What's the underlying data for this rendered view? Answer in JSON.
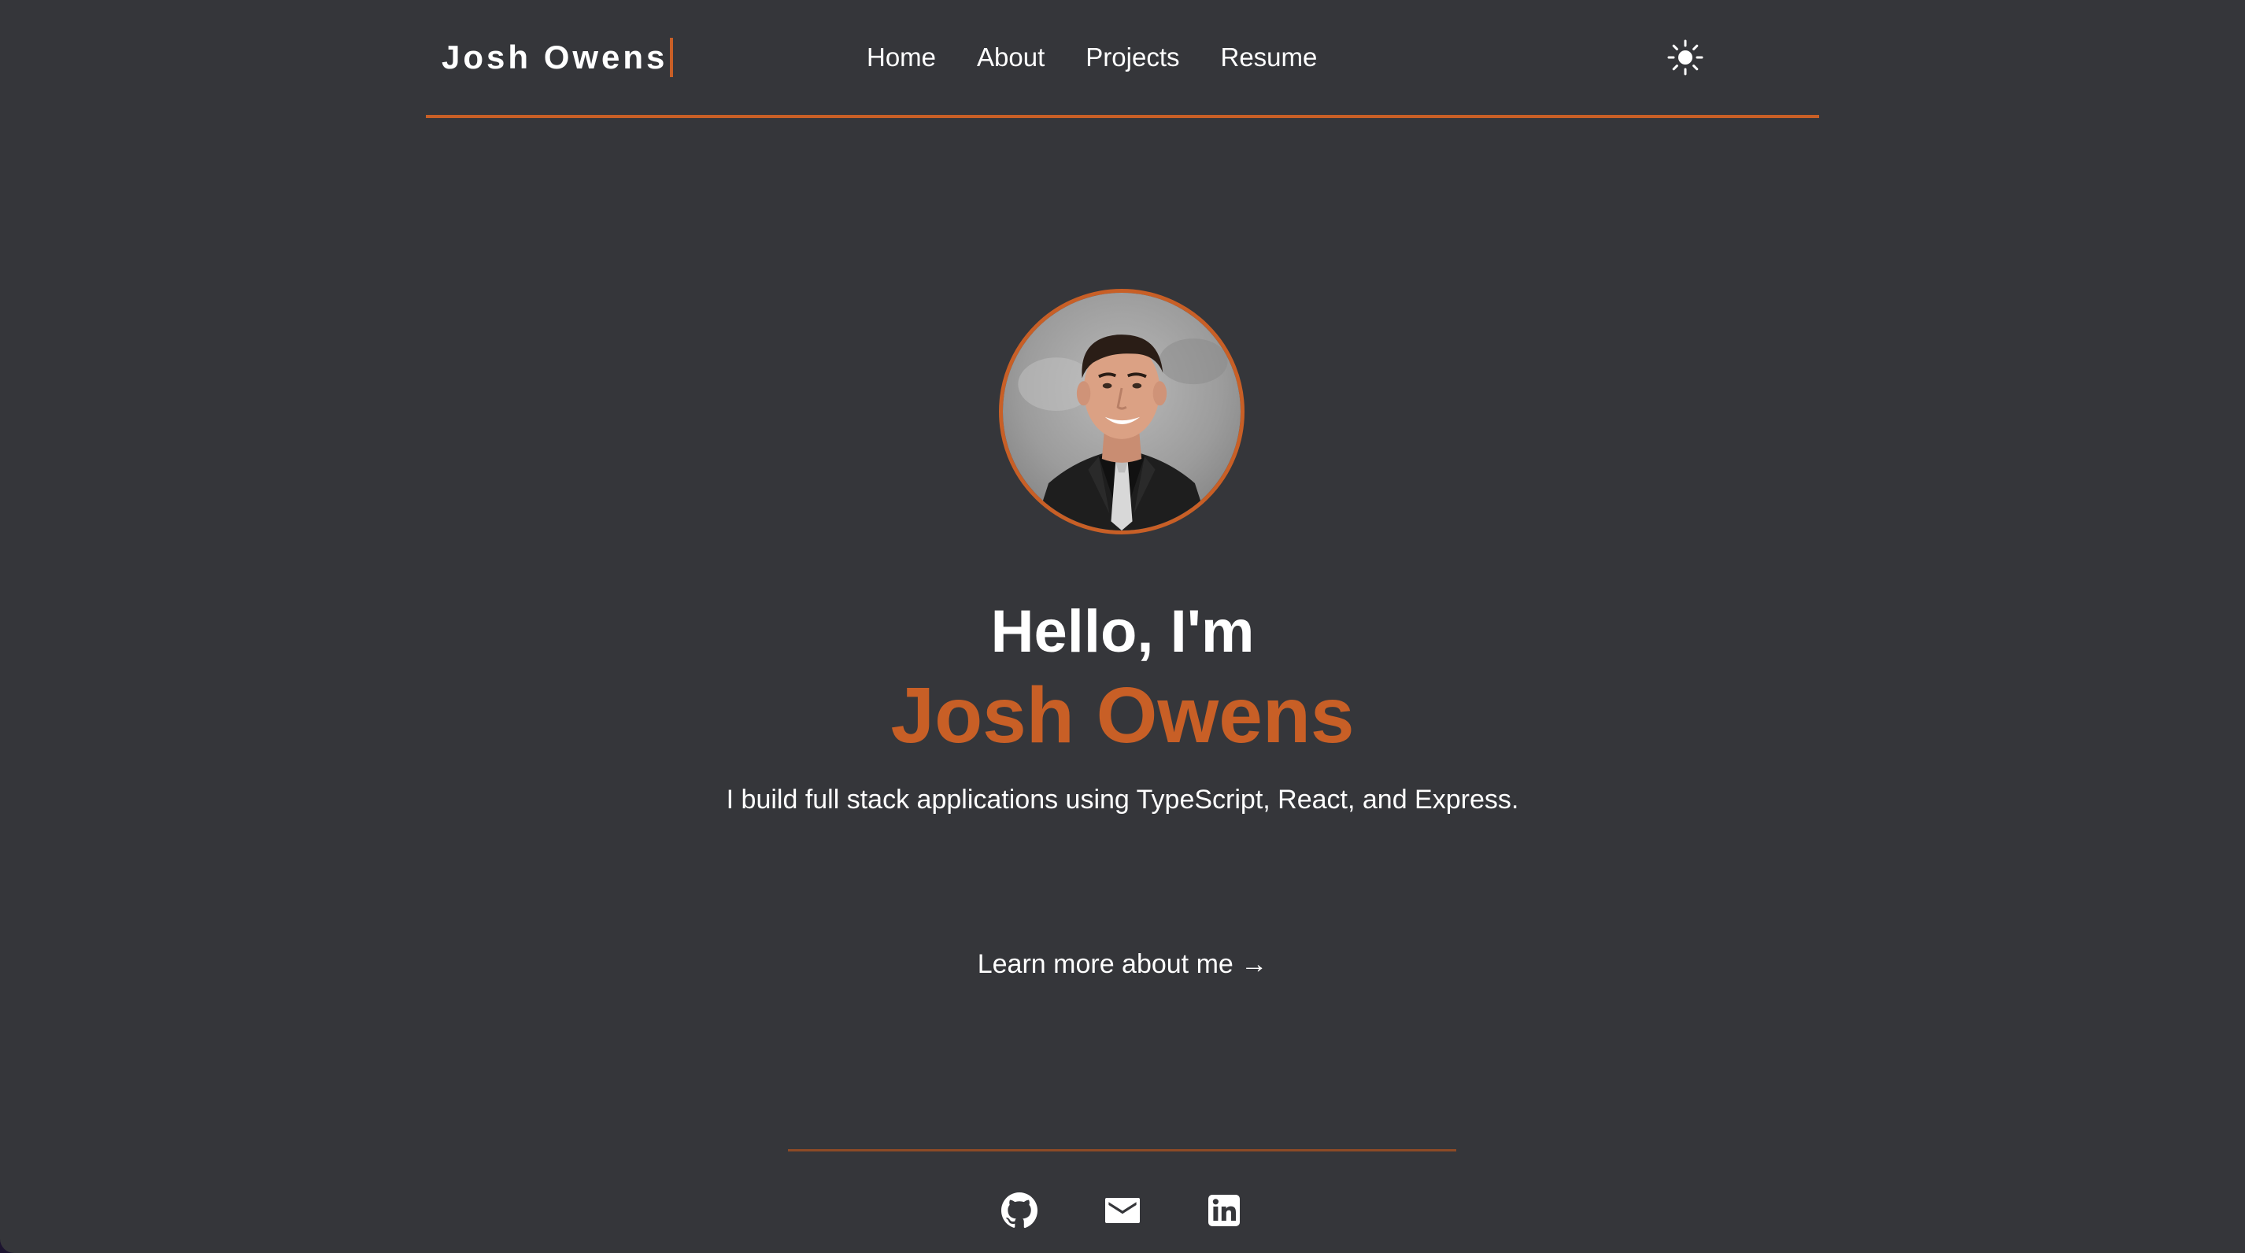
{
  "colors": {
    "background": "#35363a",
    "accent": "#c85f26",
    "text": "#ffffff"
  },
  "nav": {
    "brand": "Josh Owens",
    "links": [
      {
        "label": "Home"
      },
      {
        "label": "About"
      },
      {
        "label": "Projects"
      },
      {
        "label": "Resume"
      }
    ],
    "theme_toggle_icon": "sun-icon"
  },
  "hero": {
    "greeting": "Hello, I'm",
    "name": "Josh Owens",
    "tagline": "I build full stack applications using TypeScript, React, and Express.",
    "cta": "Learn more about me →"
  },
  "footer": {
    "social_icons": [
      "github-icon",
      "mail-icon",
      "linkedin-icon"
    ]
  }
}
